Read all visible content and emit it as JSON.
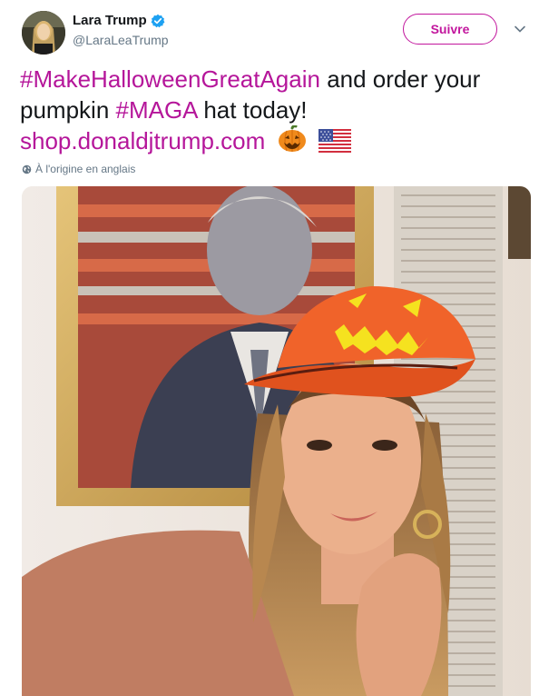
{
  "tweet": {
    "author_name": "Lara Trump",
    "author_handle": "@LaraLeaTrump",
    "verified": true,
    "follow_label": "Suivre",
    "text": {
      "hashtag1": "#MakeHalloweenGreatAgain",
      "middle": " and order your pumpkin ",
      "hashtag2": "#MAGA",
      "end": " hat today!",
      "link": "shop.donaldjtrump.com"
    },
    "emojis": [
      "jack-o-lantern-icon",
      "us-flag-icon"
    ],
    "translation_note": "À l'origine en anglais"
  },
  "colors": {
    "accent": "#b5169a",
    "text": "#14171a",
    "muted": "#657786",
    "verified": "#1da1f2"
  }
}
